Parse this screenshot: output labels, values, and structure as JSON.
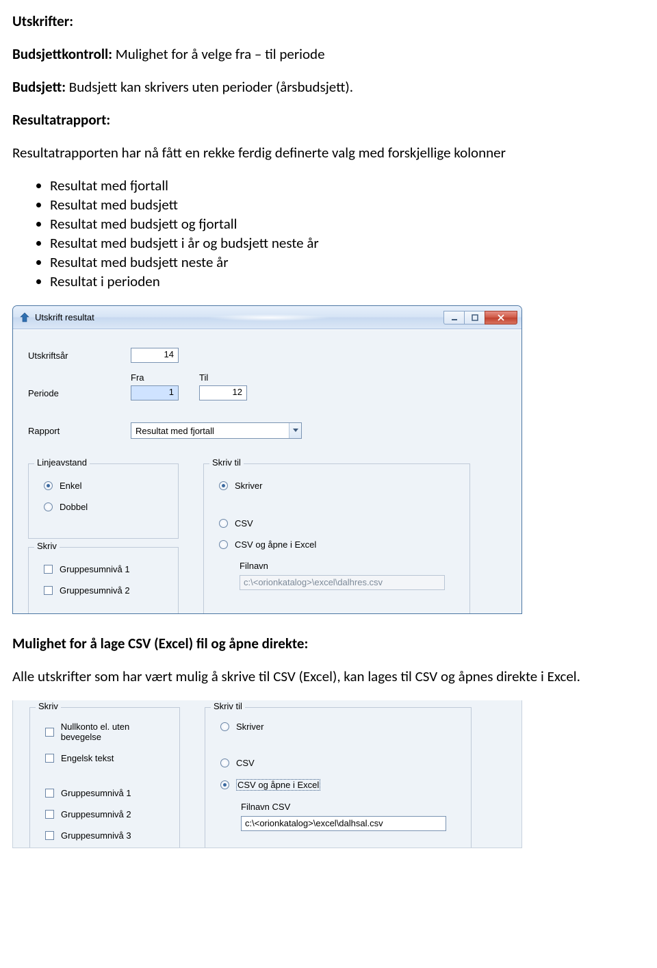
{
  "doc": {
    "h1": "Utskrifter:",
    "line1_bold": "Budsjettkontroll:",
    "line1_rest": " Mulighet for å velge fra – til periode",
    "line2_bold": "Budsjett:",
    "line2_rest": " Budsjett kan skrivers uten perioder (årsbudsjett).",
    "line3_bold": "Resultatrapport:",
    "line4": "Resultatrapporten har nå fått en rekke ferdig definerte valg med forskjellige kolonner",
    "bullets": [
      "Resultat med fjortall",
      "Resultat med budsjett",
      "Resultat med budsjett og fjortall",
      "Resultat med budsjett i år og budsjett neste år",
      "Resultat med budsjett neste år",
      "Resultat i perioden"
    ],
    "h2": "Mulighet for å lage CSV (Excel) fil og åpne direkte:",
    "line5": "Alle utskrifter som har vært mulig å skrive til CSV (Excel), kan lages til CSV og åpnes direkte i Excel."
  },
  "dlg1": {
    "title": "Utskrift resultat",
    "labels": {
      "utskriftsar": "Utskriftsår",
      "periode": "Periode",
      "fra": "Fra",
      "til": "Til",
      "rapport": "Rapport",
      "linjeavstand": "Linjeavstand",
      "enkel": "Enkel",
      "dobbel": "Dobbel",
      "skriv": "Skriv",
      "g1": "Gruppesumnivå 1",
      "g2": "Gruppesumnivå 2",
      "skrivtil": "Skriv til",
      "skriver": "Skriver",
      "csv": "CSV",
      "csvopen": "CSV og åpne i Excel",
      "filnavn": "Filnavn"
    },
    "values": {
      "utskriftsar": "14",
      "fra": "1",
      "til": "12",
      "rapport": "Resultat med fjortall",
      "filnavn": "c:\\<orionkatalog>\\excel\\dalhres.csv"
    }
  },
  "dlg2": {
    "labels": {
      "skriv": "Skriv",
      "nullkonto": "Nullkonto el. uten bevegelse",
      "engelsk": "Engelsk tekst",
      "g1": "Gruppesumnivå 1",
      "g2": "Gruppesumnivå 2",
      "g3": "Gruppesumnivå 3",
      "skrivtil": "Skriv til",
      "skriver": "Skriver",
      "csv": "CSV",
      "csvopen": "CSV og åpne i Excel",
      "filnavncsv": "Filnavn CSV"
    },
    "values": {
      "filnavn": "c:\\<orionkatalog>\\excel\\dalhsal.csv"
    }
  }
}
